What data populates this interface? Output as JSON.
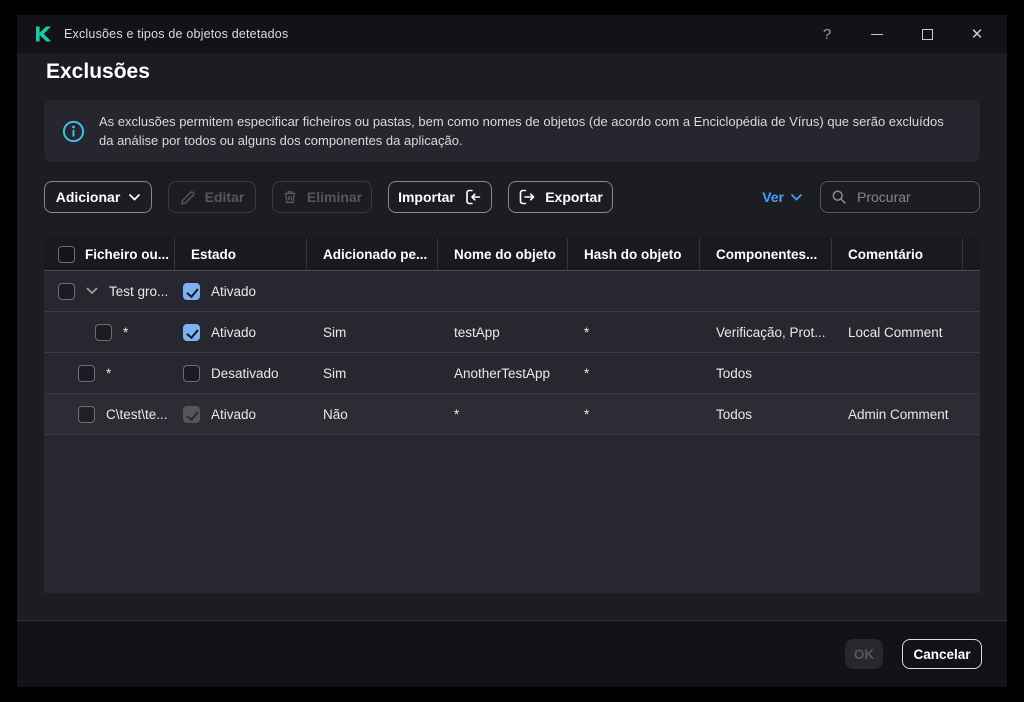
{
  "titlebar": {
    "title": "Exclusões e tipos de objetos detetados",
    "help_glyph": "?",
    "close_glyph": "✕"
  },
  "page": {
    "heading": "Exclusões",
    "banner_text": "As exclusões permitem especificar ficheiros ou pastas, bem como nomes de objetos (de acordo com a Enciclopédia de Vírus) que serão excluídos da análise por todos ou alguns dos componentes da aplicação."
  },
  "toolbar": {
    "add_label": "Adicionar",
    "edit_label": "Editar",
    "delete_label": "Eliminar",
    "import_label": "Importar",
    "export_label": "Exportar",
    "view_label": "Ver",
    "search_placeholder": "Procurar"
  },
  "table": {
    "headers": {
      "file": "Ficheiro ou...",
      "state": "Estado",
      "added_by": "Adicionado pe...",
      "object_name": "Nome do objeto",
      "object_hash": "Hash do objeto",
      "components": "Componentes...",
      "comment": "Comentário"
    },
    "rows": [
      {
        "file": "Test gro...",
        "state_label": "Ativado",
        "state_checked": true,
        "state_disabled": false,
        "added_by": "",
        "object_name": "",
        "object_hash": "",
        "components": "",
        "comment": ""
      },
      {
        "file": "*",
        "state_label": "Ativado",
        "state_checked": true,
        "state_disabled": false,
        "added_by": "Sim",
        "object_name": "testApp",
        "object_hash": "*",
        "components": "Verificação, Prot...",
        "comment": "Local Comment"
      },
      {
        "file": "*",
        "state_label": "Desativado",
        "state_checked": false,
        "state_disabled": false,
        "added_by": "Sim",
        "object_name": "AnotherTestApp",
        "object_hash": "*",
        "components": "Todos",
        "comment": ""
      },
      {
        "file": "C\\test\\te...",
        "state_label": "Ativado",
        "state_checked": true,
        "state_disabled": true,
        "added_by": "Não",
        "object_name": "*",
        "object_hash": "*",
        "components": "Todos",
        "comment": "Admin Comment"
      }
    ]
  },
  "footer": {
    "ok_label": "OK",
    "cancel_label": "Cancelar"
  },
  "colors": {
    "accent_blue": "#4d9bfa",
    "checkbox_blue": "#7fb1f2",
    "info_cyan": "#41bfe8",
    "logo_teal": "#1ec8a0"
  }
}
